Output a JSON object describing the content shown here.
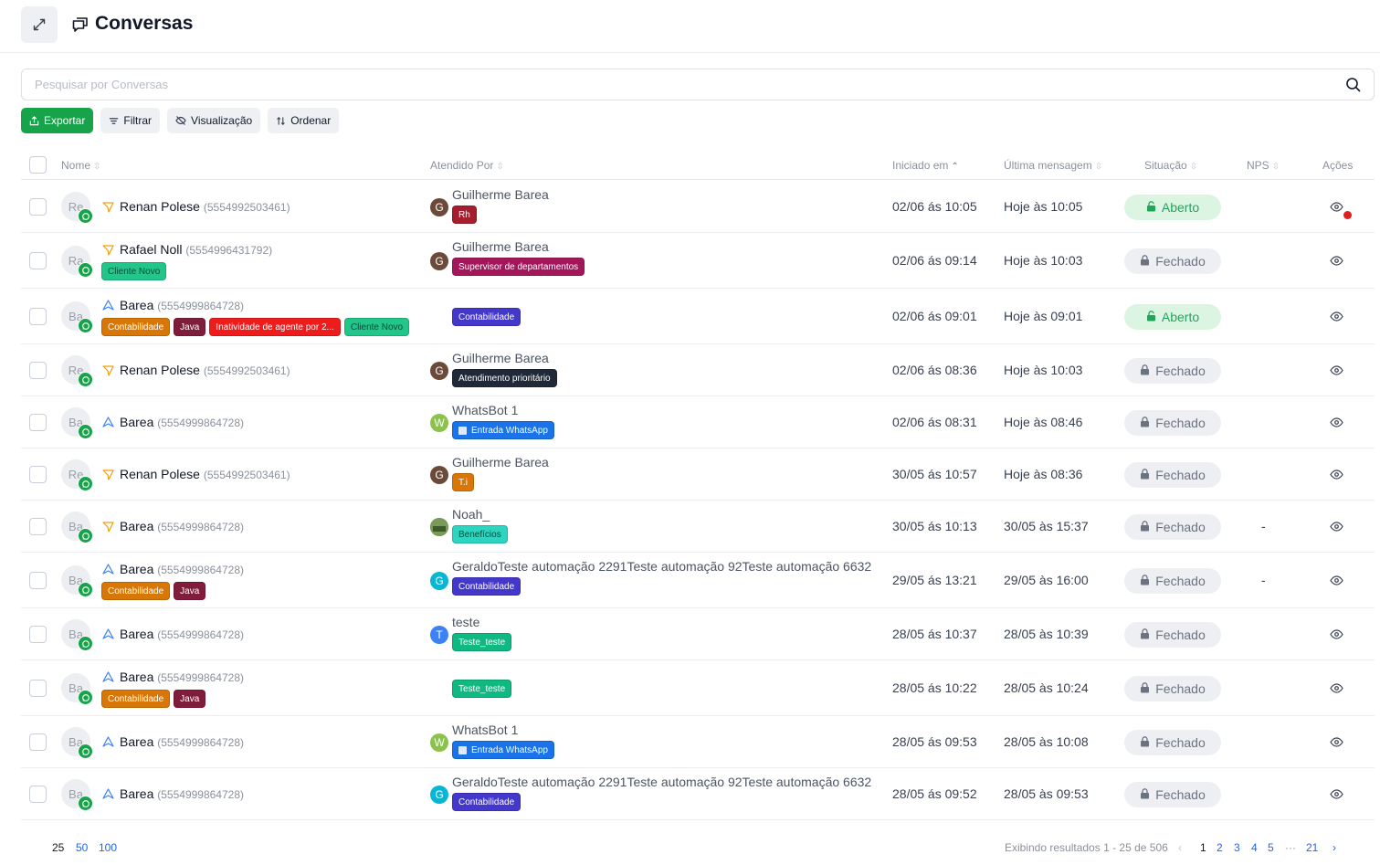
{
  "page": {
    "title": "Conversas",
    "search_placeholder": "Pesquisar por Conversas"
  },
  "colors": {
    "primary_green": "#16a34a",
    "link_blue": "#2563eb",
    "notification_red": "#e11d1d"
  },
  "toolbar": {
    "export": "Exportar",
    "filter": "Filtrar",
    "view": "Visualização",
    "sort": "Ordenar"
  },
  "columns": {
    "name": "Nome",
    "attended_by": "Atendido Por",
    "started": "Iniciado em",
    "last_message": "Última mensagem",
    "status": "Situação",
    "nps": "NPS",
    "actions": "Ações"
  },
  "rows": [
    {
      "initials": "Re",
      "name": "Renan Polese",
      "phone": "(5554992503461)",
      "channel": "orange",
      "tags": [],
      "agent": {
        "initial": "G",
        "color": "#6b4a3a",
        "name": "Guilherme Barea",
        "tags": [
          {
            "label": "Rh",
            "color": "#a51e2d"
          }
        ]
      },
      "started": "02/06 ás 10:05",
      "last": "Hoje às 10:05",
      "status": "Aberto",
      "open": true,
      "nps": "",
      "notification": true
    },
    {
      "initials": "Ra",
      "name": "Rafael Noll",
      "phone": "(5554996431792)",
      "channel": "orange",
      "tags": [
        {
          "label": "Cliente Novo",
          "color": "#22c58a",
          "dark": true
        }
      ],
      "agent": {
        "initial": "G",
        "color": "#6b4a3a",
        "name": "Guilherme Barea",
        "tags": [
          {
            "label": "Supervisor de departamentos",
            "color": "#a3165a"
          }
        ]
      },
      "started": "02/06 ás 09:14",
      "last": "Hoje às 10:03",
      "status": "Fechado",
      "open": false,
      "nps": ""
    },
    {
      "initials": "Ba",
      "name": "Barea",
      "phone": "(5554999864728)",
      "channel": "blue",
      "tags": [
        {
          "label": "Contabilidade",
          "color": "#d97706"
        },
        {
          "label": "Java",
          "color": "#7f1d3b"
        },
        {
          "label": "Inatividade de agente por 2...",
          "color": "#ef1c1c"
        },
        {
          "label": "Cliente Novo",
          "color": "#22c58a",
          "dark": true
        }
      ],
      "agent": {
        "initial": "",
        "color": "",
        "name": "",
        "tags": [
          {
            "label": "Contabilidade",
            "color": "#4338ca"
          }
        ]
      },
      "started": "02/06 ás 09:01",
      "last": "Hoje às 09:01",
      "status": "Aberto",
      "open": true,
      "nps": ""
    },
    {
      "initials": "Re",
      "name": "Renan Polese",
      "phone": "(5554992503461)",
      "channel": "orange",
      "tags": [],
      "agent": {
        "initial": "G",
        "color": "#6b4a3a",
        "name": "Guilherme Barea",
        "tags": [
          {
            "label": "Atendimento prioritário",
            "color": "#1f2937"
          }
        ]
      },
      "started": "02/06 ás 08:36",
      "last": "Hoje às 10:03",
      "status": "Fechado",
      "open": false,
      "nps": ""
    },
    {
      "initials": "Ba",
      "name": "Barea",
      "phone": "(5554999864728)",
      "channel": "blue",
      "tags": [],
      "agent": {
        "initial": "W",
        "color": "#8bc34a",
        "name": "WhatsBot 1",
        "tags": [
          {
            "label": "Entrada WhatsApp",
            "color": "#1a73e8",
            "icon": true
          }
        ]
      },
      "started": "02/06 ás 08:31",
      "last": "Hoje às 08:46",
      "status": "Fechado",
      "open": false,
      "nps": ""
    },
    {
      "initials": "Re",
      "name": "Renan Polese",
      "phone": "(5554992503461)",
      "channel": "orange",
      "tags": [],
      "agent": {
        "initial": "G",
        "color": "#6b4a3a",
        "name": "Guilherme Barea",
        "tags": [
          {
            "label": "T.i",
            "color": "#d97706"
          }
        ]
      },
      "started": "30/05 ás 10:57",
      "last": "Hoje às 08:36",
      "status": "Fechado",
      "open": false,
      "nps": ""
    },
    {
      "initials": "Ba",
      "name": "Barea",
      "phone": "(5554999864728)",
      "channel": "orange",
      "tags": [],
      "agent": {
        "initial": "",
        "color": "#5b7a3a",
        "photo": true,
        "name": "Noah_",
        "tags": [
          {
            "label": "Benefícios",
            "color": "#2dd4bf",
            "dark": true
          }
        ]
      },
      "started": "30/05 ás 10:13",
      "last": "30/05 às 15:37",
      "status": "Fechado",
      "open": false,
      "nps": "-"
    },
    {
      "initials": "Ba",
      "name": "Barea",
      "phone": "(5554999864728)",
      "channel": "blue",
      "tags": [
        {
          "label": "Contabilidade",
          "color": "#d97706"
        },
        {
          "label": "Java",
          "color": "#7f1d3b"
        }
      ],
      "agent": {
        "initial": "G",
        "color": "#06b6d4",
        "name": "GeraldoTeste automação 2291Teste automação 92Teste automação 6632",
        "tags": [
          {
            "label": "Contabilidade",
            "color": "#4338ca"
          }
        ]
      },
      "started": "29/05 ás 13:21",
      "last": "29/05 às 16:00",
      "status": "Fechado",
      "open": false,
      "nps": "-"
    },
    {
      "initials": "Ba",
      "name": "Barea",
      "phone": "(5554999864728)",
      "channel": "blue",
      "tags": [],
      "agent": {
        "initial": "T",
        "color": "#3b82f6",
        "name": "teste",
        "tags": [
          {
            "label": "Teste_teste",
            "color": "#10b981"
          }
        ]
      },
      "started": "28/05 ás 10:37",
      "last": "28/05 às 10:39",
      "status": "Fechado",
      "open": false,
      "nps": ""
    },
    {
      "initials": "Ba",
      "name": "Barea",
      "phone": "(5554999864728)",
      "channel": "blue",
      "tags": [
        {
          "label": "Contabilidade",
          "color": "#d97706"
        },
        {
          "label": "Java",
          "color": "#7f1d3b"
        }
      ],
      "agent": {
        "initial": "",
        "color": "",
        "name": "",
        "tags": [
          {
            "label": "Teste_teste",
            "color": "#10b981"
          }
        ]
      },
      "started": "28/05 ás 10:22",
      "last": "28/05 às 10:24",
      "status": "Fechado",
      "open": false,
      "nps": ""
    },
    {
      "initials": "Ba",
      "name": "Barea",
      "phone": "(5554999864728)",
      "channel": "blue",
      "tags": [],
      "agent": {
        "initial": "W",
        "color": "#8bc34a",
        "name": "WhatsBot 1",
        "tags": [
          {
            "label": "Entrada WhatsApp",
            "color": "#1a73e8",
            "icon": true
          }
        ]
      },
      "started": "28/05 ás 09:53",
      "last": "28/05 às 10:08",
      "status": "Fechado",
      "open": false,
      "nps": ""
    },
    {
      "initials": "Ba",
      "name": "Barea",
      "phone": "(5554999864728)",
      "channel": "blue",
      "tags": [],
      "agent": {
        "initial": "G",
        "color": "#06b6d4",
        "name": "GeraldoTeste automação 2291Teste automação 92Teste automação 6632",
        "tags": [
          {
            "label": "Contabilidade",
            "color": "#4338ca"
          }
        ]
      },
      "started": "28/05 ás 09:52",
      "last": "28/05 às 09:53",
      "status": "Fechado",
      "open": false,
      "nps": ""
    }
  ],
  "footer": {
    "page_sizes": [
      "25",
      "50",
      "100"
    ],
    "selected_page_size": "25",
    "results": "Exibindo resultados 1 - 25 de 506",
    "pages": [
      "1",
      "2",
      "3",
      "4",
      "5",
      "···",
      "21"
    ],
    "current_page": "1"
  }
}
